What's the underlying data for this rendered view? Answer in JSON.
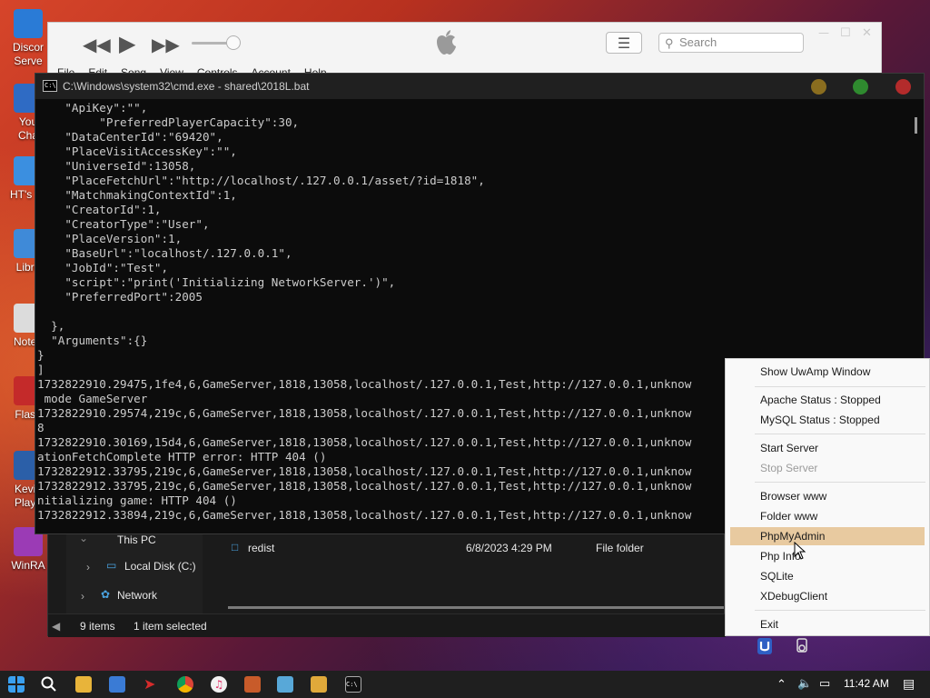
{
  "desktop": {
    "icons": [
      {
        "label": "Discord Server",
        "l1": "Discor",
        "l2": "Serve",
        "color": "#2a7bd6"
      },
      {
        "label": "YouTube Channel",
        "l1": "You",
        "l2": "Cha",
        "color": "#2f6bc4"
      },
      {
        "label": "HT's Tools",
        "l1": "HT's To",
        "l2": "",
        "color": "#3b8fe0"
      },
      {
        "label": "Libre",
        "l1": "Libre",
        "l2": "",
        "color": "#3f8ad8"
      },
      {
        "label": "Notepad",
        "l1": "Notep",
        "l2": "",
        "color": "#dcdcdc"
      },
      {
        "label": "Flash",
        "l1": "Flash",
        "l2": "",
        "color": "#c42a2a"
      },
      {
        "label": "Kevin Player",
        "l1": "Kevin",
        "l2": "Playe",
        "color": "#2b5fa8"
      },
      {
        "label": "WinRAR",
        "l1": "WinRA",
        "l2": "",
        "color": "#9b3bb5"
      }
    ]
  },
  "itunes": {
    "menu": [
      "File",
      "Edit",
      "Song",
      "View",
      "Controls",
      "Account",
      "Help"
    ],
    "search_placeholder": "Search"
  },
  "cmd": {
    "title": "C:\\Windows\\system32\\cmd.exe - shared\\2018L.bat",
    "lines": [
      "    \"ApiKey\":\"\",",
      "         \"PreferredPlayerCapacity\":30,",
      "    \"DataCenterId\":\"69420\",",
      "    \"PlaceVisitAccessKey\":\"\",",
      "    \"UniverseId\":13058,",
      "    \"PlaceFetchUrl\":\"http://localhost/.127.0.0.1/asset/?id=1818\",",
      "    \"MatchmakingContextId\":1,",
      "    \"CreatorId\":1,",
      "    \"CreatorType\":\"User\",",
      "    \"PlaceVersion\":1,",
      "    \"BaseUrl\":\"localhost/.127.0.0.1\",",
      "    \"JobId\":\"Test\",",
      "    \"script\":\"print('Initializing NetworkServer.')\",",
      "    \"PreferredPort\":2005",
      "",
      "  },",
      "  \"Arguments\":{}",
      "}",
      "]",
      "1732822910.29475,1fe4,6,GameServer,1818,13058,localhost/.127.0.0.1,Test,http://127.0.0.1,unknow",
      " mode GameServer",
      "1732822910.29574,219c,6,GameServer,1818,13058,localhost/.127.0.0.1,Test,http://127.0.0.1,unknow",
      "8",
      "1732822910.30169,15d4,6,GameServer,1818,13058,localhost/.127.0.0.1,Test,http://127.0.0.1,unknow",
      "ationFetchComplete HTTP error: HTTP 404 ()",
      "1732822912.33795,219c,6,GameServer,1818,13058,localhost/.127.0.0.1,Test,http://127.0.0.1,unknow",
      "1732822912.33795,219c,6,GameServer,1818,13058,localhost/.127.0.0.1,Test,http://127.0.0.1,unknow",
      "nitializing game: HTTP 404 ()",
      "1732822912.33894,219c,6,GameServer,1818,13058,localhost/.127.0.0.1,Test,http://127.0.0.1,unknow"
    ]
  },
  "explorer": {
    "nav": {
      "this_pc": "This PC",
      "local_disk": "Local Disk (C:)",
      "network": "Network"
    },
    "row": {
      "name": "redist",
      "date": "6/8/2023 4:29 PM",
      "type": "File folder"
    },
    "status": {
      "items": "9 items",
      "selected": "1 item selected"
    }
  },
  "context_menu": {
    "show_window": "Show UwAmp Window",
    "apache_status": "Apache Status : Stopped",
    "mysql_status": "MySQL Status : Stopped",
    "start_server": "Start Server",
    "stop_server": "Stop Server",
    "browser_www": "Browser www",
    "folder_www": "Folder www",
    "phpmyadmin": "PhpMyAdmin",
    "php_info": "Php Info",
    "sqlite": "SQLite",
    "xdebug": "XDebugClient",
    "exit": "Exit"
  },
  "taskbar": {
    "time": "11:42 AM"
  },
  "colors": {
    "menu_highlight": "#e8caa0",
    "cmd_bg": "#0c0c0c",
    "dot_yellow": "#8a6d1f",
    "dot_green": "#2f8a2f",
    "dot_red": "#b32b2b"
  }
}
